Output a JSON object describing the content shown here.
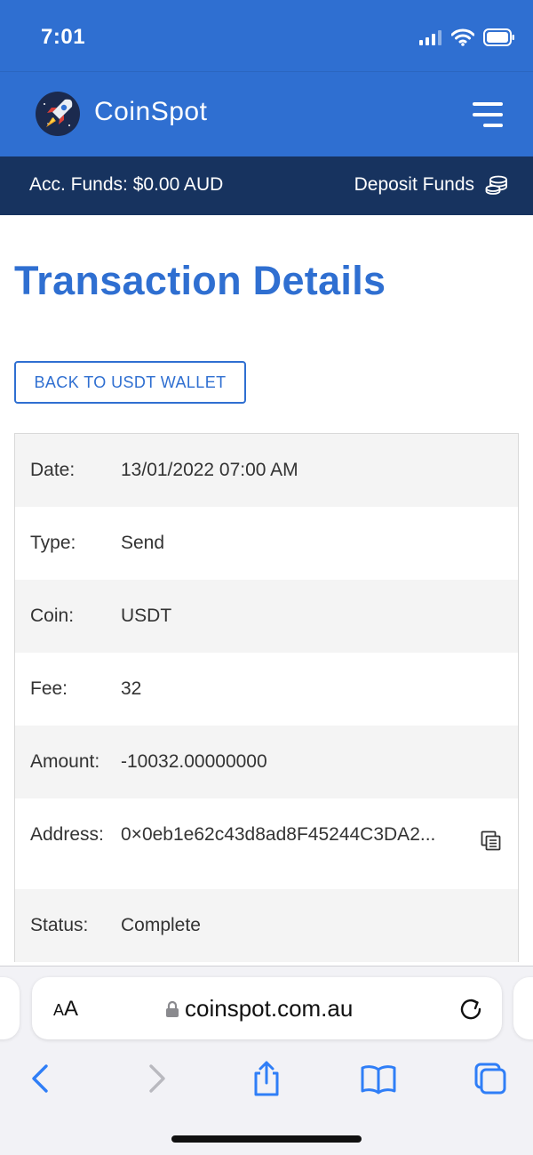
{
  "status_bar": {
    "time": "7:01"
  },
  "header": {
    "brand": "CoinSpot"
  },
  "funds_bar": {
    "account_funds": "Acc. Funds: $0.00 AUD",
    "deposit_label": "Deposit Funds"
  },
  "page": {
    "title": "Transaction Details",
    "back_button": "BACK TO USDT WALLET"
  },
  "details": [
    {
      "label": "Date:",
      "value": "13/01/2022 07:00 AM"
    },
    {
      "label": "Type:",
      "value": "Send"
    },
    {
      "label": "Coin:",
      "value": "USDT"
    },
    {
      "label": "Fee:",
      "value": "32"
    },
    {
      "label": "Amount:",
      "value": "-10032.00000000"
    },
    {
      "label": "Address:",
      "value": "0×0eb1e62c43d8ad8F45244C3DA2..."
    },
    {
      "label": "Status:",
      "value": "Complete"
    }
  ],
  "browser": {
    "text_size": {
      "small": "A",
      "big": "A"
    },
    "url": "coinspot.com.au"
  },
  "colors": {
    "primary": "#2f6fd1",
    "navy": "#17335f",
    "ios_blue": "#2f7ef7"
  },
  "icons": [
    "cellular-signal-icon",
    "wifi-icon",
    "battery-icon",
    "rocket-logo-icon",
    "hamburger-menu-icon",
    "coins-stack-icon",
    "copy-icon",
    "lock-icon",
    "reload-icon",
    "back-arrow-icon",
    "forward-arrow-icon",
    "share-icon",
    "bookmarks-icon",
    "tabs-icon"
  ]
}
